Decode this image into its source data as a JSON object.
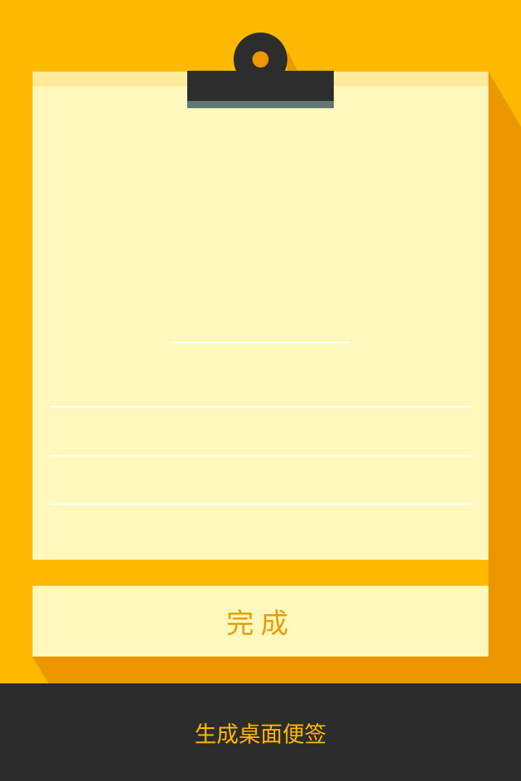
{
  "colors": {
    "background": "#FFB900",
    "shadow": "#EC9700",
    "paper": "#FEF8BC",
    "paper_top": "#FFEA99",
    "clip_dark": "#2D2D2D",
    "clip_edge": "#627676",
    "clip_hole": "#EC9700",
    "rule_line": "#FFFFFF",
    "accent_text": "#EC9A00",
    "footer_bg": "#2C2C2C",
    "footer_text": "#FFB900"
  },
  "icons": {
    "clip": "binder-clip-icon"
  },
  "note": {
    "title_value": "",
    "lines": [
      "",
      "",
      ""
    ]
  },
  "actions": {
    "done_label": "完成"
  },
  "footer": {
    "label": "生成桌面便签"
  }
}
